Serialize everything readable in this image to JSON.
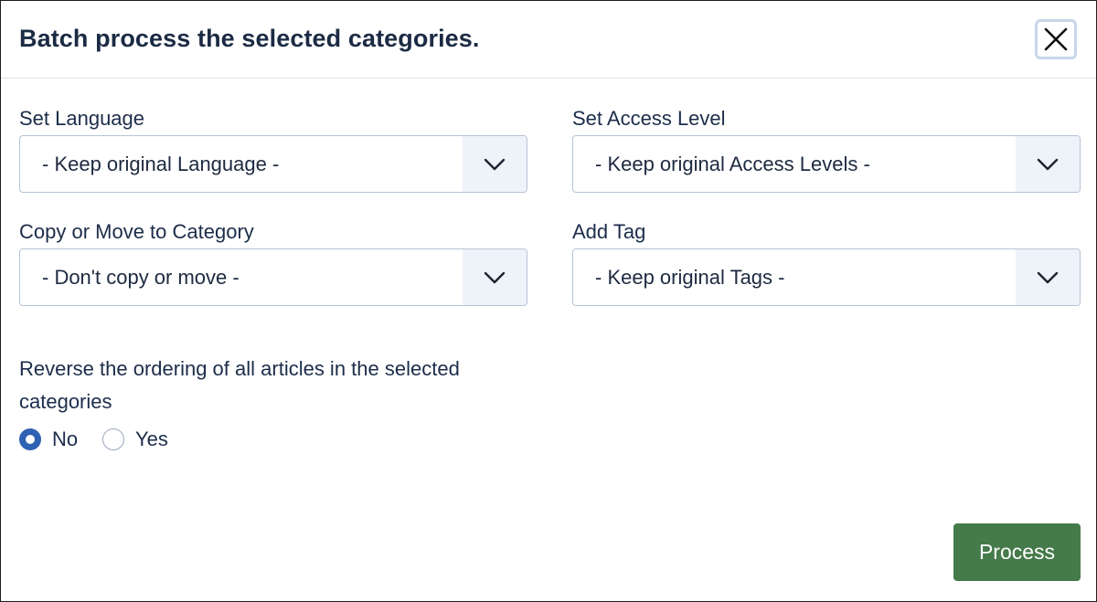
{
  "dialog": {
    "title": "Batch process the selected categories.",
    "close_icon": "close-icon"
  },
  "fields": {
    "language": {
      "label": "Set Language",
      "value": "- Keep original Language -"
    },
    "access": {
      "label": "Set Access Level",
      "value": "- Keep original Access Levels -"
    },
    "category": {
      "label": "Copy or Move to Category",
      "value": "- Don't copy or move -"
    },
    "tag": {
      "label": "Add Tag",
      "value": "- Keep original Tags -"
    }
  },
  "reverse": {
    "label": "Reverse the ordering of all articles in the selected categories",
    "options": [
      {
        "label": "No",
        "checked": true
      },
      {
        "label": "Yes",
        "checked": false
      }
    ]
  },
  "actions": {
    "process_label": "Process"
  },
  "colors": {
    "title": "#1c2b44",
    "primary_button": "#457a4a",
    "radio_checked": "#2f62b0",
    "select_caret_bg": "#eef2f9",
    "select_border": "#b7c4d6"
  }
}
